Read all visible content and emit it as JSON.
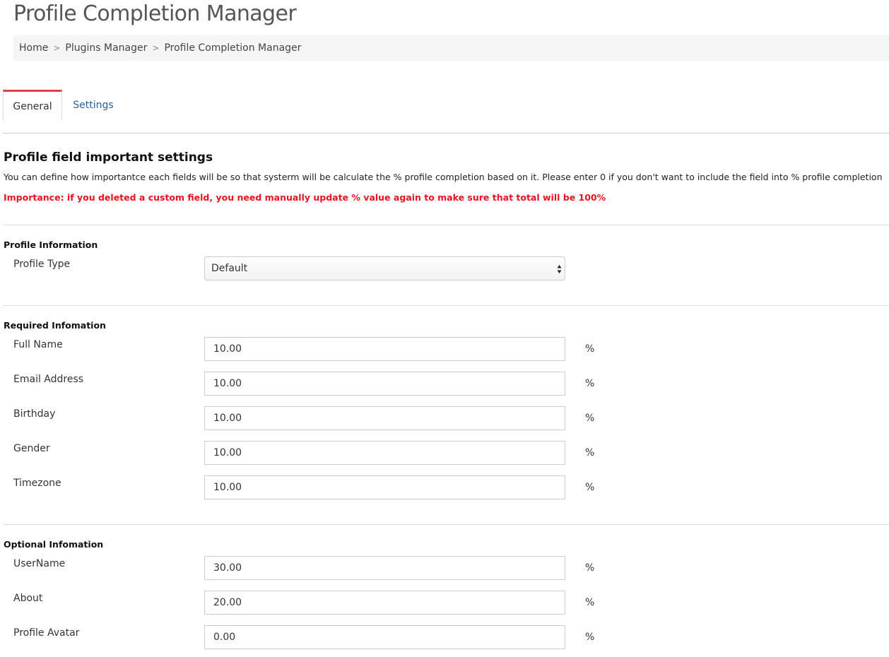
{
  "page": {
    "title": "Profile Completion Manager"
  },
  "breadcrumb": {
    "items": [
      "Home",
      "Plugins Manager",
      "Profile Completion Manager"
    ],
    "separator": ">"
  },
  "tabs": [
    {
      "label": "General",
      "active": true
    },
    {
      "label": "Settings",
      "active": false
    }
  ],
  "settings": {
    "heading": "Profile field important settings",
    "description": "You can define how importantce each fields will be so that systerm will be calculate the % profile completion based on it. Please enter 0 if you don't want to include the field into % profile completion",
    "warning": "Importance: if you deleted a custom field, you need manually update % value again to make sure that total will be 100%"
  },
  "profile_information": {
    "title": "Profile Information",
    "profile_type": {
      "label": "Profile Type",
      "selected": "Default",
      "icon": "select-arrows-icon"
    }
  },
  "required_information": {
    "title": "Required Infomation",
    "fields": [
      {
        "label": "Full Name",
        "value": "10.00",
        "unit": "%"
      },
      {
        "label": "Email Address",
        "value": "10.00",
        "unit": "%"
      },
      {
        "label": "Birthday",
        "value": "10.00",
        "unit": "%"
      },
      {
        "label": "Gender",
        "value": "10.00",
        "unit": "%"
      },
      {
        "label": "Timezone",
        "value": "10.00",
        "unit": "%"
      }
    ]
  },
  "optional_information": {
    "title": "Optional Infomation",
    "fields": [
      {
        "label": "UserName",
        "value": "30.00",
        "unit": "%"
      },
      {
        "label": "About",
        "value": "20.00",
        "unit": "%"
      },
      {
        "label": "Profile Avatar",
        "value": "0.00",
        "unit": "%"
      }
    ]
  },
  "colors": {
    "active_tab_accent": "#e4404a",
    "link": "#2a6496",
    "warning": "#e8131f",
    "breadcrumb_background": "#f5f5f5"
  }
}
